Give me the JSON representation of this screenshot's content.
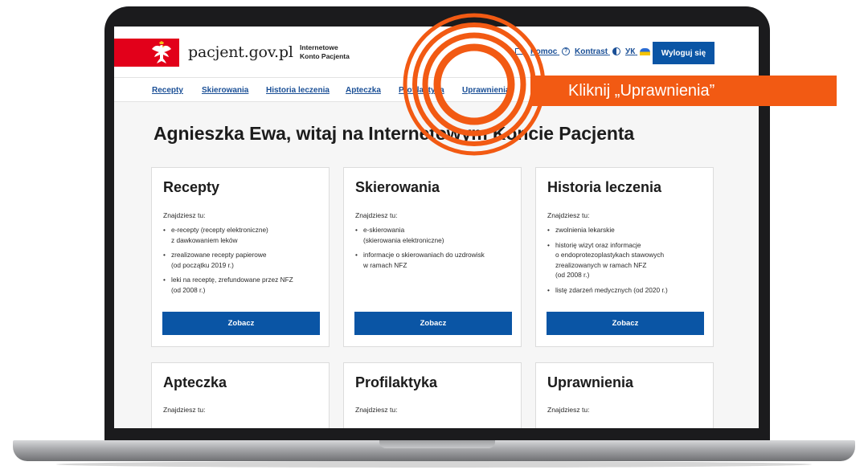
{
  "header": {
    "site_name": "pacjent.gov.pl",
    "subtitle_line1": "Internetowe",
    "subtitle_line2": "Konto Pacjenta",
    "links": {
      "pomoc": "Pomoc",
      "kontrast": "Kontrast",
      "uk": "УК"
    },
    "logout_label": "Wyloguj się"
  },
  "nav": {
    "items": [
      "Recepty",
      "Skierowania",
      "Historia leczenia",
      "Apteczka",
      "Profilaktyka",
      "Uprawnienia"
    ]
  },
  "main": {
    "heading": "Agnieszka Ewa, witaj na Internetowym Koncie Pacjenta",
    "cards": [
      {
        "title": "Recepty",
        "intro": "Znajdziesz tu:",
        "items": [
          [
            "e-recepty (recepty elektroniczne)",
            "z dawkowaniem leków"
          ],
          [
            "zrealizowane recepty papierowe",
            "(od początku 2019 r.)"
          ],
          [
            "leki na receptę, zrefundowane przez NFZ",
            "(od 2008 r.)"
          ]
        ],
        "button": "Zobacz"
      },
      {
        "title": "Skierowania",
        "intro": "Znajdziesz tu:",
        "items": [
          [
            "e-skierowania",
            "(skierowania elektroniczne)"
          ],
          [
            "informacje o skierowaniach do uzdrowisk",
            "w ramach NFZ"
          ]
        ],
        "button": "Zobacz"
      },
      {
        "title": "Historia leczenia",
        "intro": "Znajdziesz tu:",
        "items": [
          [
            "zwolnienia lekarskie"
          ],
          [
            "historię wizyt oraz informacje",
            "o endoprotezoplastykach stawowych",
            "zrealizowanych w ramach NFZ",
            "(od 2008 r.)"
          ],
          [
            "listę zdarzeń medycznych (od 2020 r.)"
          ]
        ],
        "button": "Zobacz"
      },
      {
        "title": "Apteczka",
        "intro": "Znajdziesz tu:"
      },
      {
        "title": "Profilaktyka",
        "intro": "Znajdziesz tu:"
      },
      {
        "title": "Uprawnienia",
        "intro": "Znajdziesz tu:"
      }
    ]
  },
  "overlay": {
    "callout": "Kliknij „Uprawnienia”"
  },
  "colors": {
    "brand_blue": "#0a55a5",
    "link_blue": "#1a4f96",
    "flag_red": "#e2001a",
    "highlight_orange": "#f25a13"
  },
  "icons": [
    "white-eagle-icon",
    "mail-icon",
    "help-icon",
    "contrast-icon",
    "ukraine-flag-icon",
    "target-rings-icon"
  ]
}
